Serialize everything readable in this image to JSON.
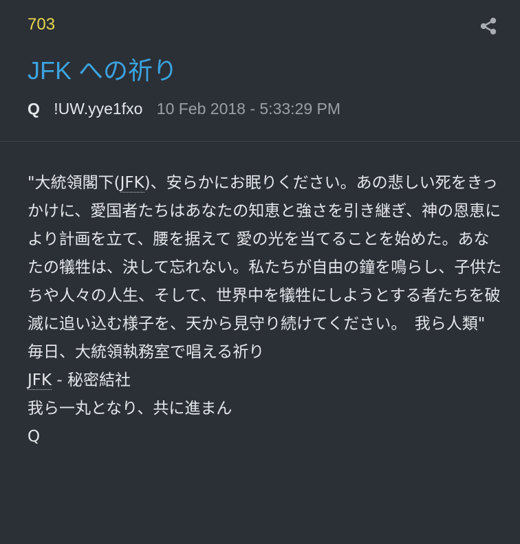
{
  "post": {
    "number": "703",
    "title": "JFK への祈り",
    "author": "Q",
    "tripcode": "!UW.yye1fxo",
    "timestamp": "10 Feb 2018 - 5:33:29 PM",
    "share_icon": "share-icon"
  },
  "body": {
    "quote_open": "\"大統領閣下(",
    "quote_abbr": "JFK",
    "quote_rest": ")、安らかにお眠りください。あの悲しい死をきっかけに、愛国者たちはあなたの知恵と強さを引き継ぎ、神の恩恵により計画を立て、腰を据えて 愛の光を当てることを始めた。あなたの犠牲は、決して忘れない。私たちが自由の鐘を鳴らし、子供たちや人々の人生、そして、世界中を犠牲にしようとする者たちを破滅に追い込む様子を、天から見守り続けてください。　我ら人類\"",
    "line1": "毎日、大統領執務室で唱える祈り",
    "line2_abbr": "JFK",
    "line2_rest": " - 秘密結社",
    "line3": "我ら一丸となり、共に進まん",
    "signature": "Q"
  },
  "colors": {
    "background": "#2b2f36",
    "post_number": "#e6d84c",
    "title": "#3ba3df",
    "date": "#9aa0a8",
    "text": "#e4e6ea"
  }
}
